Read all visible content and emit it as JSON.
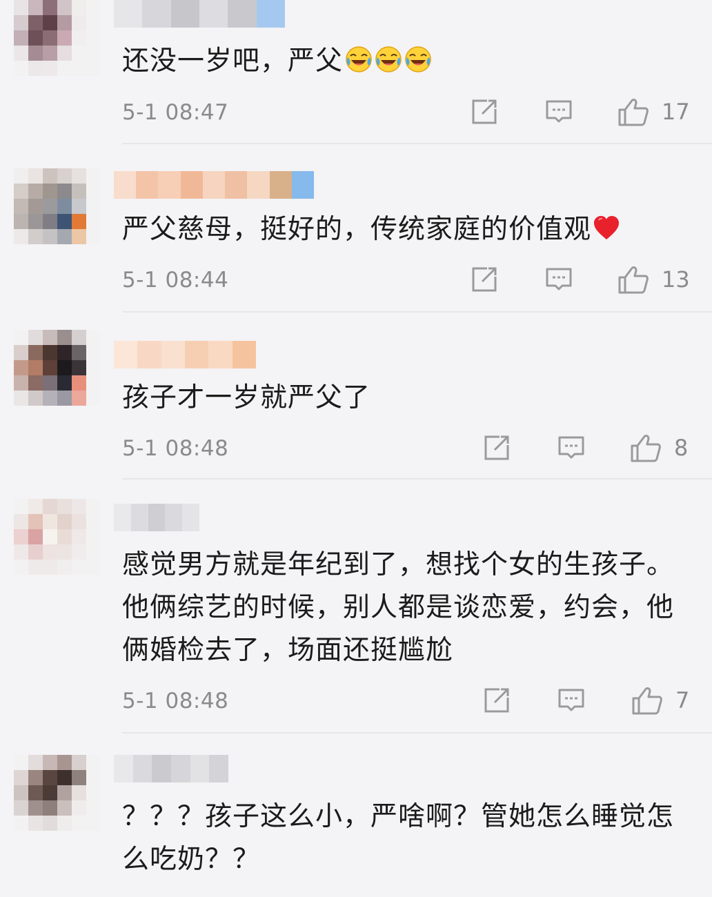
{
  "comments": [
    {
      "text": "还没一岁吧，严父",
      "emojis": [
        "laugh-cry-icon",
        "laugh-cry-icon",
        "laugh-cry-icon"
      ],
      "time": "5-1 08:47",
      "likes": "17",
      "avatar_colors": [
        "#e8e4e6",
        "#c9b7bd",
        "#8c6f78",
        "#d1c4c8",
        "#f0eded",
        "#f3f2f3",
        "#d6cbcf",
        "#7e6168",
        "#5e4049",
        "#b49aa2",
        "#efeaec",
        "#f3f2f3",
        "#c2b0b6",
        "#6d5058",
        "#8a6d75",
        "#caa9b4",
        "#f1eef0",
        "#f3f2f3",
        "#ebe6e8",
        "#a58c94",
        "#b89ea6",
        "#e5dde0",
        "#f3f2f3",
        "#f3f2f3",
        "#f3f2f3",
        "#ece8ea",
        "#ede9eb",
        "#f3f2f3",
        "#f3f2f3",
        "#f3f2f3"
      ],
      "username_colors": [
        "#e6e5e8",
        "#d7d6da",
        "#c7c6cb",
        "#dddce0",
        "#c9c8cd",
        "#a5c8f0"
      ]
    },
    {
      "text": "严父慈母，挺好的，传统家庭的价值观",
      "emojis": [
        "red-heart-icon"
      ],
      "time": "5-1 08:44",
      "likes": "13",
      "avatar_colors": [
        "#f0eeee",
        "#e9e4e2",
        "#cdc3be",
        "#d8d1ce",
        "#e6e1df",
        "#f3f2f3",
        "#d5cdc8",
        "#b7aca5",
        "#a09690",
        "#8c8a8c",
        "#c6c0bd",
        "#f3f2f3",
        "#c4bab4",
        "#a39a95",
        "#9b9a9d",
        "#7e8ca0",
        "#c7c9cc",
        "#f3f2f3",
        "#bcb4b0",
        "#9b9698",
        "#807d85",
        "#3d5475",
        "#e07a36",
        "#f3f2f3",
        "#ece9e8",
        "#d2ccca",
        "#c5c2c3",
        "#a4a8b0",
        "#ebc7a6",
        "#f3f2f3"
      ],
      "username_colors": [
        "#f8dccc",
        "#f3c4a8",
        "#f7cfb6",
        "#f1b898",
        "#f6d4c0",
        "#efc0a3",
        "#f5d7c2",
        "#d8b08a",
        "#86b9ec"
      ]
    },
    {
      "text": "孩子才一岁就严父了",
      "emojis": [],
      "time": "5-1 08:48",
      "likes": "8",
      "avatar_colors": [
        "#f3f2f3",
        "#e1dcdc",
        "#c8bcbb",
        "#9b8e8e",
        "#d5cfcf",
        "#f3f2f3",
        "#d9cecc",
        "#8a6a5f",
        "#4c3630",
        "#2d2527",
        "#6a6466",
        "#f3f2f3",
        "#c39a8a",
        "#b37c67",
        "#5e4038",
        "#1c1a1d",
        "#3a3438",
        "#f3f2f3",
        "#c9b3ad",
        "#8b6b63",
        "#7b6f78",
        "#2a2a34",
        "#e88f7c",
        "#f3f2f3",
        "#eae6e6",
        "#d1c9c9",
        "#b5b1b8",
        "#9a98a2",
        "#eba79a",
        "#f3f2f3"
      ],
      "username_colors": [
        "#fbe6d8",
        "#f8d8c4",
        "#fae0cf",
        "#f6cfb3",
        "#fad9c2",
        "#f5c49e"
      ]
    },
    {
      "text": "感觉男方就是年纪到了，想找个女的生孩子。他俩综艺的时候，别人都是谈恋爱，约会，他俩婚检去了，场面还挺尴尬",
      "emojis": [],
      "time": "5-1 08:48",
      "likes": "7",
      "avatar_colors": [
        "#f3f2f3",
        "#efe9e8",
        "#e5d8d4",
        "#e9dfdc",
        "#ede8e7",
        "#f3f2f3",
        "#ece6e4",
        "#e3c2b7",
        "#efe6df",
        "#e2d2cc",
        "#ebe1de",
        "#f3f2f3",
        "#ebd1d0",
        "#d9a2a3",
        "#f6f2ee",
        "#e9dcd7",
        "#eee9e8",
        "#f3f2f3",
        "#efe8e8",
        "#e7cfcf",
        "#ede3e1",
        "#ebe4e2",
        "#f0ecec",
        "#f3f2f3",
        "#f3f2f3",
        "#efeaea",
        "#eeeaea",
        "#f1eeee",
        "#f3f2f3",
        "#f3f2f3"
      ],
      "username_colors": [
        "#e9e8eb",
        "#dcdbdf",
        "#cfced3",
        "#dad9dd",
        "#e4e3e6"
      ]
    },
    {
      "text": "？？？孩子这么小，严啥啊？管她怎么睡觉怎么吃奶？？",
      "emojis": [],
      "time": "",
      "likes": "",
      "avatar_colors": [
        "#f3f2f3",
        "#e2dcdc",
        "#c7b8b5",
        "#a89591",
        "#d8d0cf",
        "#f3f2f3",
        "#ddd6d5",
        "#9a8580",
        "#5a4640",
        "#3e302d",
        "#8e817e",
        "#f3f2f3",
        "#cdc4c2",
        "#6e5a55",
        "#4b3b37",
        "#b0a29f",
        "#e6e0df",
        "#f3f2f3",
        "#d9d3d2",
        "#a0908d",
        "#8e7f7c",
        "#c9c0be",
        "#f0ecec",
        "#f3f2f3",
        "#f3f2f3",
        "#e8e4e3",
        "#e1dcdb",
        "#efecec",
        "#f3f2f3",
        "#f3f2f3"
      ],
      "username_colors": [
        "#e8e7ea",
        "#dad9dd",
        "#cbcacf",
        "#d6d5d9",
        "#e2e1e4",
        "#d4d3d7"
      ]
    }
  ],
  "accent_colors": {
    "icon_gray": "#9a9a9a",
    "text": "#1b1b1b",
    "meta_text": "#8a8a8a"
  }
}
